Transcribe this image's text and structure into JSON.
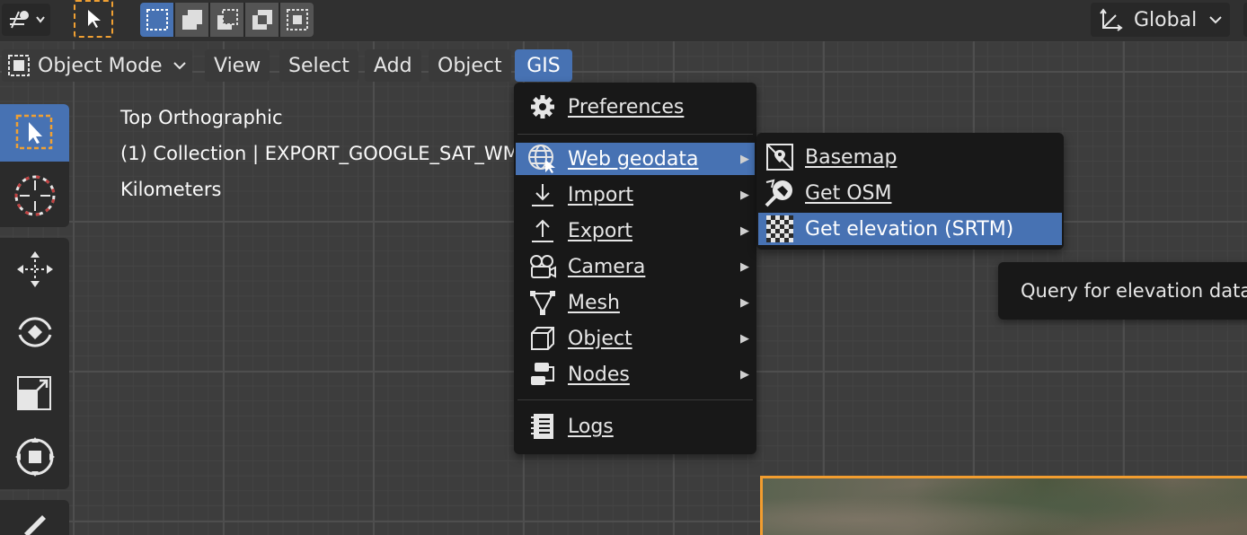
{
  "header": {
    "global_label": "Global"
  },
  "menubar": {
    "object_mode": "Object Mode",
    "items": [
      "View",
      "Select",
      "Add",
      "Object",
      "GIS"
    ]
  },
  "viewport": {
    "view_name": "Top Orthographic",
    "collection_info": "(1) Collection | EXPORT_GOOGLE_SAT_WM",
    "units": "Kilometers"
  },
  "gis_menu": {
    "items": [
      {
        "label": "Preferences",
        "icon": "gear-icon",
        "submenu": false
      },
      {
        "label": "Web geodata",
        "icon": "globe-cursor-icon",
        "submenu": true
      },
      {
        "label": "Import",
        "icon": "import-arrow-icon",
        "submenu": true
      },
      {
        "label": "Export",
        "icon": "export-arrow-icon",
        "submenu": true
      },
      {
        "label": "Camera",
        "icon": "camera-icon",
        "submenu": true
      },
      {
        "label": "Mesh",
        "icon": "mesh-triangle-icon",
        "submenu": true
      },
      {
        "label": "Object",
        "icon": "cube-icon",
        "submenu": true
      },
      {
        "label": "Nodes",
        "icon": "nodes-icon",
        "submenu": true
      },
      {
        "label": "Logs",
        "icon": "log-book-icon",
        "submenu": false
      }
    ]
  },
  "web_geodata_menu": {
    "items": [
      {
        "label": "Basemap",
        "icon": "basemap-icon"
      },
      {
        "label": "Get OSM",
        "icon": "osm-icon"
      },
      {
        "label": "Get elevation (SRTM)",
        "icon": "checker-icon"
      }
    ]
  },
  "tooltip": {
    "text": "Query for elevation data"
  },
  "colors": {
    "accent": "#4772b3",
    "selection_outline": "#f29d2f",
    "menu_bg": "#181818"
  }
}
